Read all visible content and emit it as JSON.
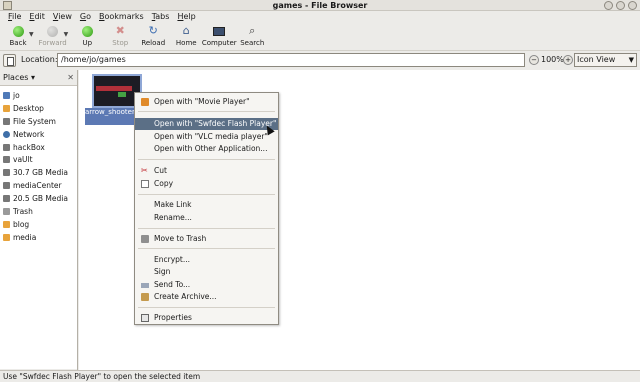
{
  "window": {
    "title": "games - File Browser"
  },
  "menubar": [
    {
      "before": "",
      "key": "F",
      "after": "ile"
    },
    {
      "before": "",
      "key": "E",
      "after": "dit"
    },
    {
      "before": "",
      "key": "V",
      "after": "iew"
    },
    {
      "before": "",
      "key": "G",
      "after": "o"
    },
    {
      "before": "",
      "key": "B",
      "after": "ookmarks"
    },
    {
      "before": "",
      "key": "T",
      "after": "abs"
    },
    {
      "before": "",
      "key": "H",
      "after": "elp"
    }
  ],
  "toolbar": {
    "back": "Back",
    "forward": "Forward",
    "up": "Up",
    "stop": "Stop",
    "reload": "Reload",
    "home": "Home",
    "computer": "Computer",
    "search": "Search"
  },
  "location": {
    "label": "Location:",
    "value": "/home/jo/games",
    "zoom": "100%",
    "view_mode": "Icon View"
  },
  "sidebar": {
    "header": "Places",
    "items": [
      {
        "label": "jo",
        "icon": "home-icon",
        "color": "#4f7ab8"
      },
      {
        "label": "Desktop",
        "icon": "desktop-folder-icon",
        "color": "#e8a33b"
      },
      {
        "label": "File System",
        "icon": "drive-icon",
        "color": "#777777"
      },
      {
        "label": "Network",
        "icon": "network-icon",
        "color": "#3f6fa8"
      },
      {
        "label": "hackBox",
        "icon": "drive-icon",
        "color": "#777777"
      },
      {
        "label": "vaUlt",
        "icon": "drive-icon",
        "color": "#777777"
      },
      {
        "label": "30.7 GB Media",
        "icon": "drive-icon",
        "color": "#777777"
      },
      {
        "label": "mediaCenter",
        "icon": "drive-icon",
        "color": "#777777"
      },
      {
        "label": "20.5 GB Media",
        "icon": "drive-icon",
        "color": "#777777"
      },
      {
        "label": "Trash",
        "icon": "trash-icon",
        "color": "#9a9a9a"
      },
      {
        "label": "blog",
        "icon": "folder-icon",
        "color": "#e8a33b"
      },
      {
        "label": "media",
        "icon": "folder-icon",
        "color": "#e8a33b"
      }
    ]
  },
  "file": {
    "name": "arrow_shooter.swf"
  },
  "context_menu": {
    "items": [
      {
        "label": "Open with \"Movie Player\"",
        "icon": "movie-player-icon"
      },
      {
        "label": "Open with \"Swfdec Flash Player\"",
        "highlighted": true
      },
      {
        "label": "Open with \"VLC media player\""
      },
      {
        "label": "Open with Other Application..."
      },
      {
        "label": "Cut",
        "icon": "scissors-icon"
      },
      {
        "label": "Copy",
        "icon": "copy-icon"
      },
      {
        "label": "Make Link"
      },
      {
        "label": "Rename..."
      },
      {
        "label": "Move to Trash",
        "icon": "trash-icon"
      },
      {
        "label": "Encrypt..."
      },
      {
        "label": "Sign"
      },
      {
        "label": "Send To...",
        "icon": "send-to-icon"
      },
      {
        "label": "Create Archive...",
        "icon": "archive-icon"
      },
      {
        "label": "Properties",
        "icon": "properties-icon"
      }
    ]
  },
  "status": "Use \"Swfdec Flash Player\" to open the selected item",
  "colors": {
    "selection": "#5b6f86",
    "file_label_bg": "#5c79b4"
  }
}
